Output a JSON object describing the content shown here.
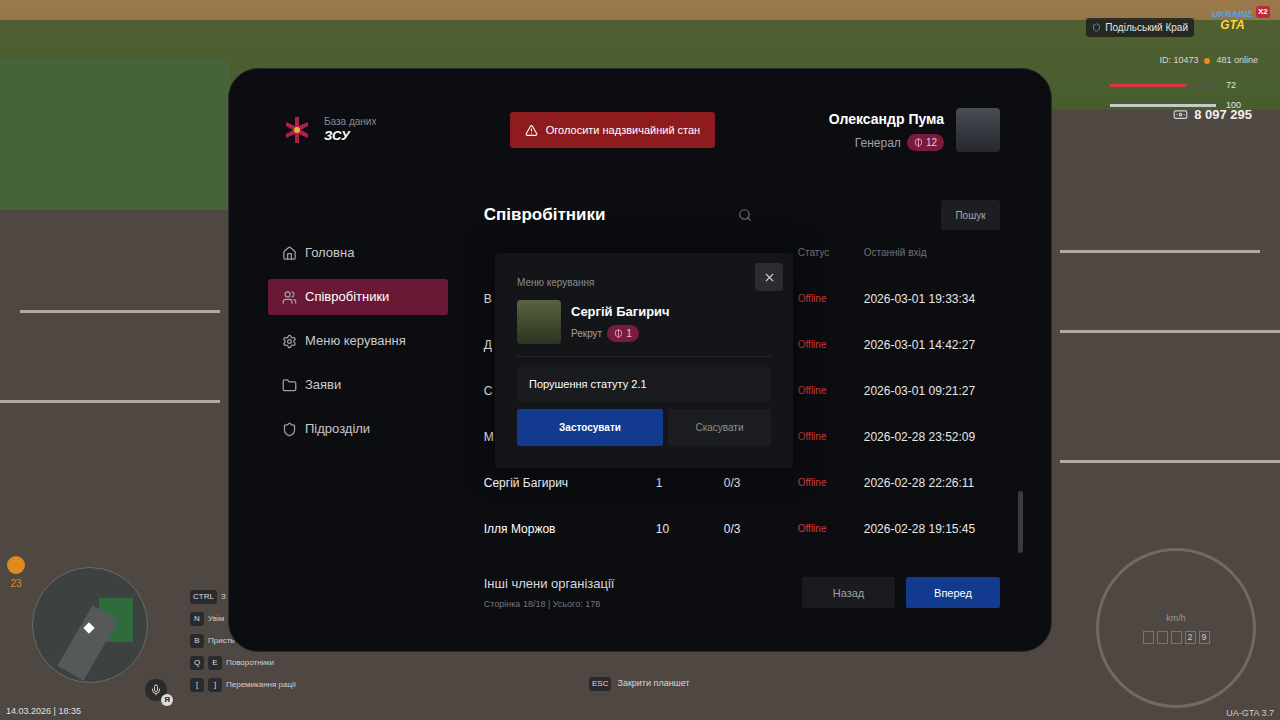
{
  "server": {
    "name": "Подільський Край",
    "logo_top": "UKRAINE",
    "logo_bottom": "GTA",
    "logo_badge": "X2",
    "id": "ID: 10473",
    "online": "481 online"
  },
  "vitals": [
    {
      "kind": "health",
      "level": 0.72,
      "reading": "72",
      "color": "#d83a3a"
    },
    {
      "kind": "armor",
      "level": 1,
      "reading": "100",
      "color": "#c8c8c8"
    }
  ],
  "money": "8 097 295",
  "hunger": "23",
  "key_hints": [
    {
      "keys": [
        "CTRL"
      ],
      "label": "З"
    },
    {
      "keys": [
        "N"
      ],
      "label": "Увім"
    },
    {
      "keys": [
        "B"
      ],
      "label": "Присть"
    },
    {
      "keys": [
        "Q",
        "E"
      ],
      "label": "Поворотники"
    },
    {
      "keys": [
        "[",
        "]"
      ],
      "label": "Перемикання рації"
    }
  ],
  "voice": {
    "badge": "Я"
  },
  "datetime": "14.03.2026 | 18:35",
  "esc_hint": {
    "key": "ESC",
    "label": "Закрити планшет"
  },
  "speedometer": {
    "unit": "km/h",
    "digits": [
      "",
      "",
      "",
      "2",
      "9"
    ]
  },
  "version": "UA-GTA 3.7",
  "tablet": {
    "brand": {
      "subtitle": "База даних",
      "title": "ЗСУ"
    },
    "emergency_button": "Оголосити надзвичайний стан",
    "user": {
      "name": "Олександр Пума",
      "rank": "Генерал",
      "level": "12"
    },
    "sidebar": {
      "items": [
        {
          "label": "Головна",
          "icon": "home",
          "selected": false
        },
        {
          "label": "Співробітники",
          "icon": "users",
          "selected": true
        },
        {
          "label": "Меню керування",
          "icon": "gear",
          "selected": false
        },
        {
          "label": "Заяви",
          "icon": "folder",
          "selected": false
        },
        {
          "label": "Підрозділи",
          "icon": "shield",
          "selected": false
        }
      ]
    },
    "page_title": "Співробітники",
    "search": {
      "placeholder": "",
      "button": "Пошук"
    },
    "table": {
      "columns": [
        {
          "label": "Статус"
        },
        {
          "label": "Останній вхід"
        }
      ],
      "rows": [
        {
          "name": "В",
          "rank": "",
          "reprimands": "",
          "status": "Offline",
          "color": "#d13b3b",
          "last_login": "2026-03-01 19:33:34"
        },
        {
          "name": "Д",
          "rank": "",
          "reprimands": "",
          "status": "Offline",
          "color": "#d13b3b",
          "last_login": "2026-03-01 14:42:27"
        },
        {
          "name": "С",
          "rank": "",
          "reprimands": "",
          "status": "Offline",
          "color": "#d13b3b",
          "last_login": "2026-03-01 09:21:27"
        },
        {
          "name": "М",
          "rank": "",
          "reprimands": "",
          "status": "Offline",
          "color": "#d13b3b",
          "last_login": "2026-02-28 23:52:09"
        },
        {
          "name": "Сергій Багирич",
          "rank": "1",
          "reprimands": "0/3",
          "status": "Offline",
          "color": "#d13b3b",
          "last_login": "2026-02-28 22:26:11"
        },
        {
          "name": "Ілля Моржов",
          "rank": "10",
          "reprimands": "0/3",
          "status": "Offline",
          "color": "#d13b3b",
          "last_login": "2026-02-28 19:15:45"
        }
      ]
    },
    "footer": {
      "title": "Інші члени організації",
      "page_info": "Сторінка 18/18 | Усього: 178",
      "prev": "Назад",
      "next": "Вперед"
    },
    "modal": {
      "title": "Меню керування",
      "name": "Сергій Багирич",
      "rank": "Рекрут",
      "level": "1",
      "input_value": "Порушення статуту 2.1",
      "apply": "Застосувати",
      "cancel": "Скасувати"
    }
  }
}
